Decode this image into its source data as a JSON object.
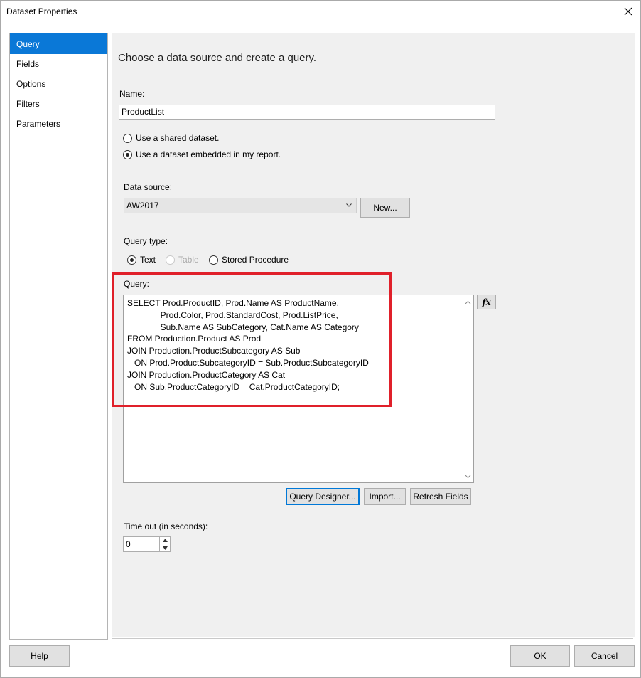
{
  "window": {
    "title": "Dataset Properties"
  },
  "nav": {
    "items": [
      {
        "label": "Query",
        "selected": true
      },
      {
        "label": "Fields"
      },
      {
        "label": "Options"
      },
      {
        "label": "Filters"
      },
      {
        "label": "Parameters"
      }
    ]
  },
  "main": {
    "heading": "Choose a data source and create a query.",
    "name_label": "Name:",
    "name_value": "ProductList",
    "shared_dataset_label": "Use a shared dataset.",
    "embedded_dataset_label": "Use a dataset embedded in my report.",
    "data_source_label": "Data source:",
    "data_source_value": "AW2017",
    "new_button": "New...",
    "query_type_label": "Query type:",
    "query_type_options": [
      "Text",
      "Table",
      "Stored Procedure"
    ],
    "query_label": "Query:",
    "query_text": "SELECT Prod.ProductID, Prod.Name AS ProductName,\n              Prod.Color, Prod.StandardCost, Prod.ListPrice,\n              Sub.Name AS SubCategory, Cat.Name AS Category\nFROM Production.Product AS Prod\nJOIN Production.ProductSubcategory AS Sub\n   ON Prod.ProductSubcategoryID = Sub.ProductSubcategoryID\nJOIN Production.ProductCategory AS Cat\n   ON Sub.ProductCategoryID = Cat.ProductCategoryID;",
    "expression_button": "fx",
    "query_designer_button": "Query Designer...",
    "import_button": "Import...",
    "refresh_fields_button": "Refresh Fields",
    "timeout_label": "Time out (in seconds):",
    "timeout_value": "0"
  },
  "footer": {
    "help_button": "Help",
    "ok_button": "OK",
    "cancel_button": "Cancel"
  },
  "colors": {
    "selection": "#0a78d7",
    "highlight_border": "#e0202a"
  },
  "icons": {
    "close": "close-icon",
    "dropdown": "chevron-down-icon",
    "scroll_up": "scroll-up-arrow-icon",
    "scroll_down": "scroll-down-arrow-icon",
    "spin_up": "spin-up-icon",
    "spin_down": "spin-down-icon"
  }
}
